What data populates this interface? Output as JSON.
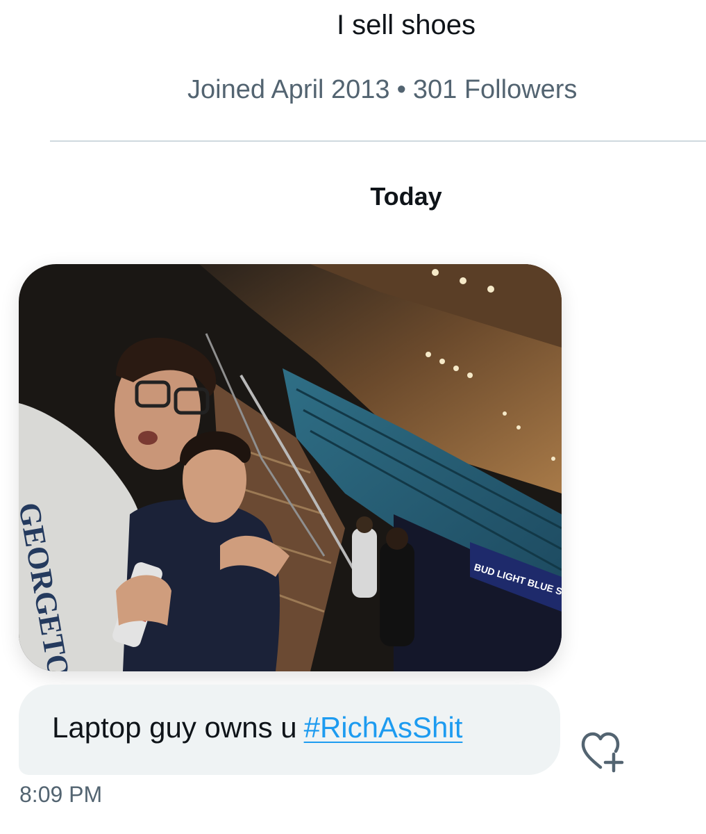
{
  "profile": {
    "bio": "I sell shoes",
    "joined": "Joined April 2013",
    "separator": "•",
    "followers": "301 Followers"
  },
  "conversation": {
    "day_label": "Today",
    "message": {
      "text": "Laptop guy owns u",
      "hashtag": "#RichAsShit",
      "time": "8:09 PM",
      "image_alt": "Selfie of two young men at an arena with blue seats",
      "image_text": {
        "shirt": "GEORGETOWN",
        "sign": "BUD LIGHT BLUE SEATS"
      }
    },
    "react_icon": "heart-plus-icon"
  },
  "colors": {
    "text": "#0f1419",
    "secondary": "#536471",
    "divider": "#cfd9de",
    "bubble": "#eff3f4",
    "link": "#1d9bf0"
  }
}
